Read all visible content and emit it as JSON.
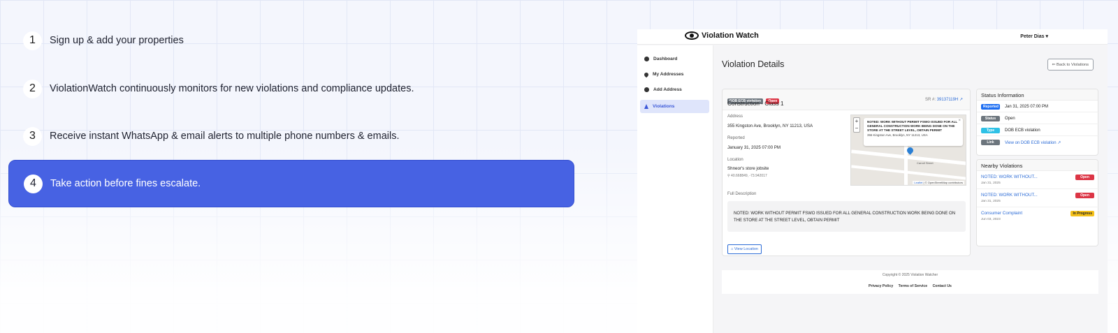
{
  "steps": [
    {
      "num": "1",
      "text": "Sign up & add your properties"
    },
    {
      "num": "2",
      "text": "ViolationWatch continuously monitors for new violations and compliance updates."
    },
    {
      "num": "3",
      "text": "Receive instant WhatsApp & email alerts to multiple phone numbers & emails."
    },
    {
      "num": "4",
      "text": "Take action before fines escalate.",
      "active": true
    }
  ],
  "colors": {
    "accent": "#4762e3",
    "link": "#2b6bd6",
    "open_badge": "#dc3545",
    "in_progress_badge": "#f5c11a"
  },
  "app": {
    "brand": "Violation Watch",
    "user": "Peter Dias ▾",
    "sidebar": [
      {
        "label": "Dashboard",
        "icon": "dashboard-icon"
      },
      {
        "label": "My Addresses",
        "icon": "map-pin-icon"
      },
      {
        "label": "Add Address",
        "icon": "plus-circle-icon"
      },
      {
        "label": "Violations",
        "icon": "warning-icon",
        "active": true
      }
    ],
    "page_title": "Violation Details",
    "back_button": "⇐ Back to Violations",
    "details": {
      "badge_type": "DOB ECB violation",
      "badge_status": "Open",
      "subtitle": "Construction - Class 1",
      "sr_label": "SR #:",
      "sr_value": "39137119H ↗",
      "address_label": "Address",
      "address": "355 Kingston Ave, Brooklyn, NY 11213, USA",
      "reported_label": "Reported",
      "reported": "January 31, 2025 07:00 PM",
      "location_label": "Location",
      "location": "Shneor's store jobsite",
      "coords": "⚲ 40.668849, -73.942017",
      "description_label": "Full Description",
      "description": "NOTED: WORK WITHOUT PERMIT FSWO ISSUED FOR ALL GENERAL CONSTRUCTION WORK BEING DONE ON THE STORE AT THE STREET LEVEL, OBTAIN PERMIT",
      "view_location": "⌂ View Location"
    },
    "map": {
      "zoom_in": "+",
      "zoom_out": "−",
      "popup_title": "NOTED: WORK WITHOUT PERMIT FSWO ISSUED FOR ALL GENERAL CONSTRUCTION WORK BEING DONE ON THE STORE AT THE STREET LEVEL, OBTAIN PERMIT",
      "popup_address": "355 Kingston Ave, Brooklyn, NY 11213, USA",
      "popup_close": "×",
      "street": "Carroll Street",
      "attribution_link": "Leaflet",
      "attribution_text": " | © OpenStreetMap contributors"
    },
    "status": {
      "title": "Status Information",
      "rows": [
        {
          "badge": "Reported",
          "value": "Jan 31, 2025 07:00 PM",
          "color": "#1d6ef2"
        },
        {
          "badge": "Status",
          "value": "Open",
          "color": "#6c757d"
        },
        {
          "badge": "Type",
          "value": "DOB ECB violation",
          "color": "#2ec1e6"
        },
        {
          "badge": "Link",
          "value": "View on DOB ECB violation ↗",
          "color": "#6c757d",
          "is_link": true
        }
      ]
    },
    "nearby": {
      "title": "Nearby Violations",
      "rows": [
        {
          "title": "NOTED: WORK WITHOUT...",
          "date": "Jan 31, 2025",
          "badge": "Open"
        },
        {
          "title": "NOTED: WORK WITHOUT...",
          "date": "Jan 31, 2025",
          "badge": "Open"
        },
        {
          "title": "Consumer Complaint",
          "date": "Jun 03, 2023",
          "badge": "In Progress"
        }
      ]
    },
    "footer": {
      "copyright": "Copyright © 2025 Violation Watcher",
      "links": [
        "Privacy Policy",
        "Terms of Service",
        "Contact Us"
      ]
    }
  }
}
